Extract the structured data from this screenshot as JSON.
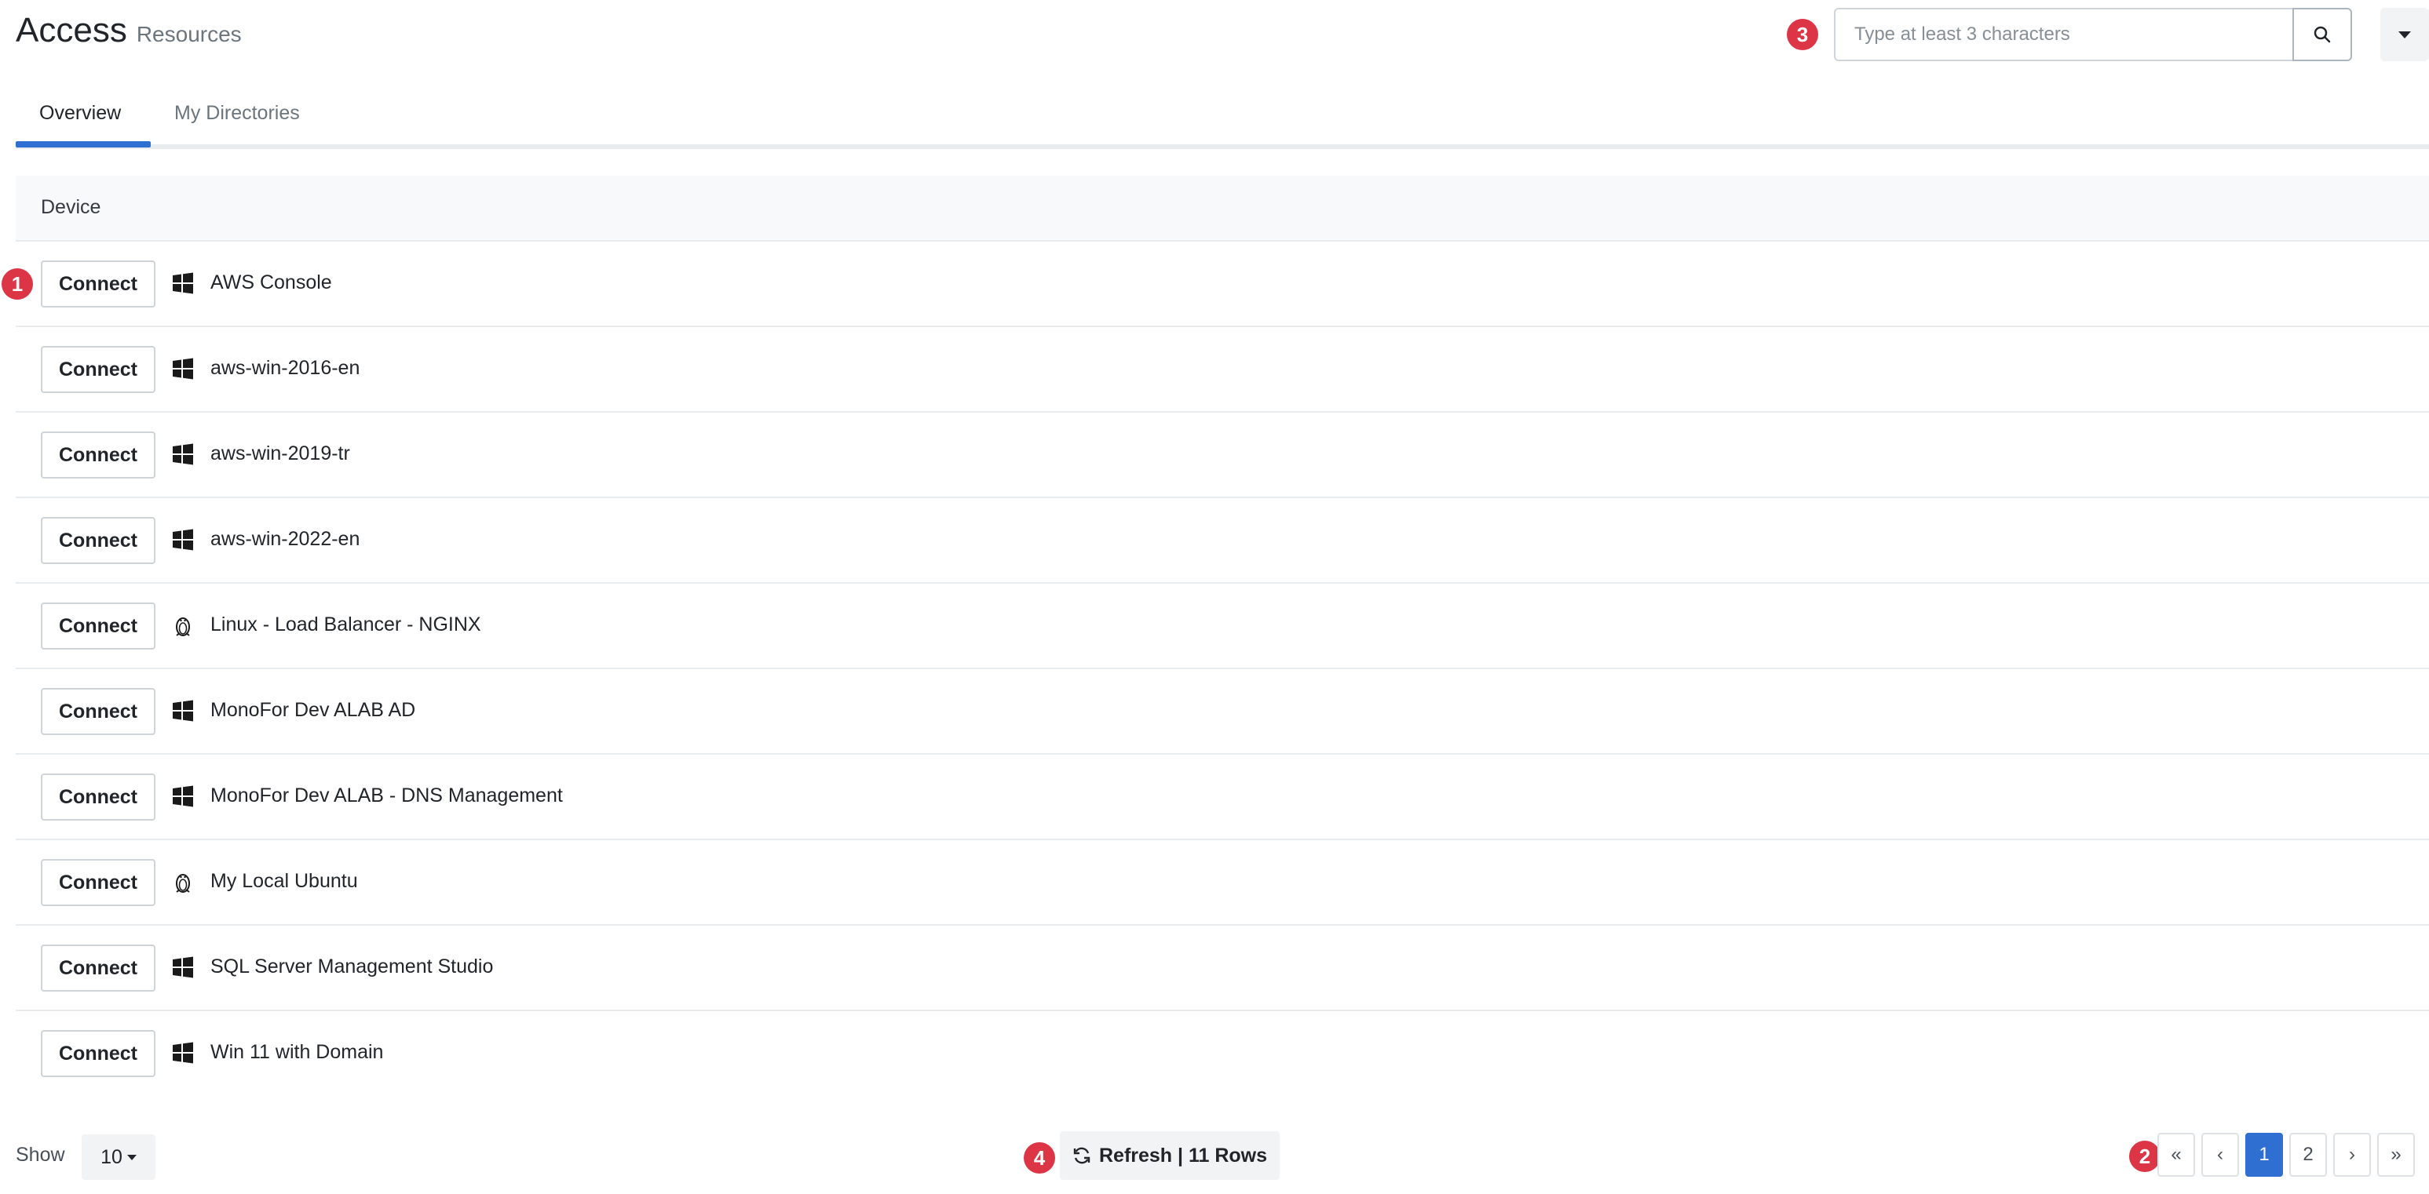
{
  "header": {
    "title": "Access",
    "subtitle": "Resources"
  },
  "search": {
    "placeholder": "Type at least 3 characters"
  },
  "tabs": [
    {
      "label": "Overview",
      "active": true
    },
    {
      "label": "My Directories",
      "active": false
    }
  ],
  "table": {
    "column": "Device",
    "connect_label": "Connect",
    "rows": [
      {
        "name": "AWS Console",
        "os": "windows-icon"
      },
      {
        "name": "aws-win-2016-en",
        "os": "windows-icon"
      },
      {
        "name": "aws-win-2019-tr",
        "os": "windows-icon"
      },
      {
        "name": "aws-win-2022-en",
        "os": "windows-icon"
      },
      {
        "name": "Linux - Load Balancer - NGINX",
        "os": "linux-icon"
      },
      {
        "name": "MonoFor Dev ALAB AD",
        "os": "windows-icon"
      },
      {
        "name": "MonoFor Dev ALAB - DNS Management",
        "os": "windows-icon"
      },
      {
        "name": "My Local Ubuntu",
        "os": "linux-icon"
      },
      {
        "name": "SQL Server Management Studio",
        "os": "windows-icon"
      },
      {
        "name": "Win 11 with Domain",
        "os": "windows-icon"
      }
    ]
  },
  "footer": {
    "show_label": "Show",
    "page_size": "10",
    "refresh_label": "Refresh | 11 Rows",
    "pagination": {
      "first": "«",
      "prev": "‹",
      "pages": [
        "1",
        "2"
      ],
      "current": "1",
      "next": "›",
      "last": "»"
    }
  },
  "annotations": [
    "1",
    "2",
    "3",
    "4"
  ],
  "colors": {
    "accent": "#2f6fd1",
    "badge": "#dc3545"
  }
}
